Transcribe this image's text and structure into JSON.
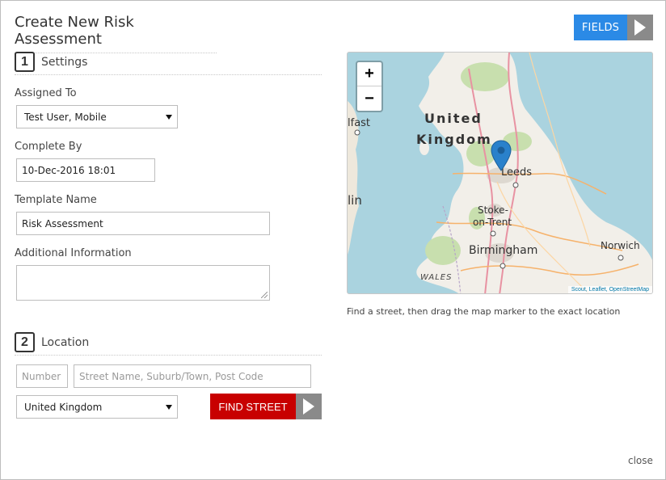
{
  "dialog": {
    "title": "Create New Risk Assessment",
    "fields_button": "FIELDS",
    "close_label": "close"
  },
  "settings": {
    "step_number": "1",
    "heading": "Settings",
    "assigned_to_label": "Assigned To",
    "assigned_to_value": "Test User, Mobile",
    "complete_by_label": "Complete By",
    "complete_by_value": "10-Dec-2016 18:01",
    "template_name_label": "Template Name",
    "template_name_value": "Risk Assessment",
    "additional_info_label": "Additional Information",
    "additional_info_value": ""
  },
  "location": {
    "step_number": "2",
    "heading": "Location",
    "number_placeholder": "Number",
    "street_placeholder": "Street Name, Suburb/Town, Post Code",
    "country_value": "United Kingdom",
    "find_street_button": "FIND STREET"
  },
  "map": {
    "zoom_in": "+",
    "zoom_out": "−",
    "labels": {
      "united": "United",
      "kingdom": "Kingdom",
      "belfast": "lfast",
      "dublin": "lin",
      "leeds": "Leeds",
      "stoke": "Stoke-",
      "on_trent": "on-Trent",
      "birmingham": "Birmingham",
      "norwich": "Norwich",
      "wales": "WALES"
    },
    "attribution": "Scout, Leaflet, OpenStreetMap",
    "caption": "Find a street, then drag the map marker to the exact location"
  },
  "colors": {
    "fields_blue": "#2b8ae6",
    "find_red": "#c80000",
    "arrow_grey": "#8a8a8a",
    "marker_blue": "#2a81cb"
  }
}
